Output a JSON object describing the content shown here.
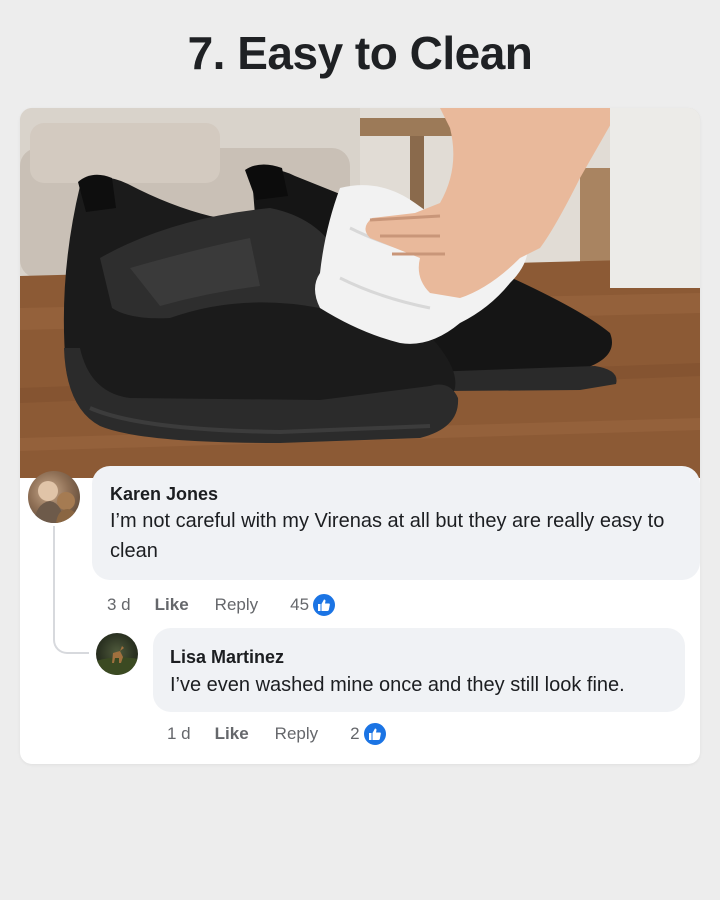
{
  "heading": "7. Easy to Clean",
  "photo": {
    "subject": "black-velcro-shoes-being-wiped"
  },
  "comments": [
    {
      "author": "Karen Jones",
      "text": "I’m not careful with my Virenas at all but they are really easy to clean",
      "time": "3 d",
      "like_label": "Like",
      "reply_label": "Reply",
      "reactions": "45"
    },
    {
      "author": "Lisa Martinez",
      "text": "I’ve even washed mine once and they still look fine.",
      "time": "1 d",
      "like_label": "Like",
      "reply_label": "Reply",
      "reactions": "2"
    }
  ],
  "icons": {
    "reaction": "thumbs-up-icon"
  },
  "colors": {
    "reaction_blue": "#1b74e4",
    "bubble_bg": "#f0f2f5",
    "meta_text": "#65676b"
  }
}
